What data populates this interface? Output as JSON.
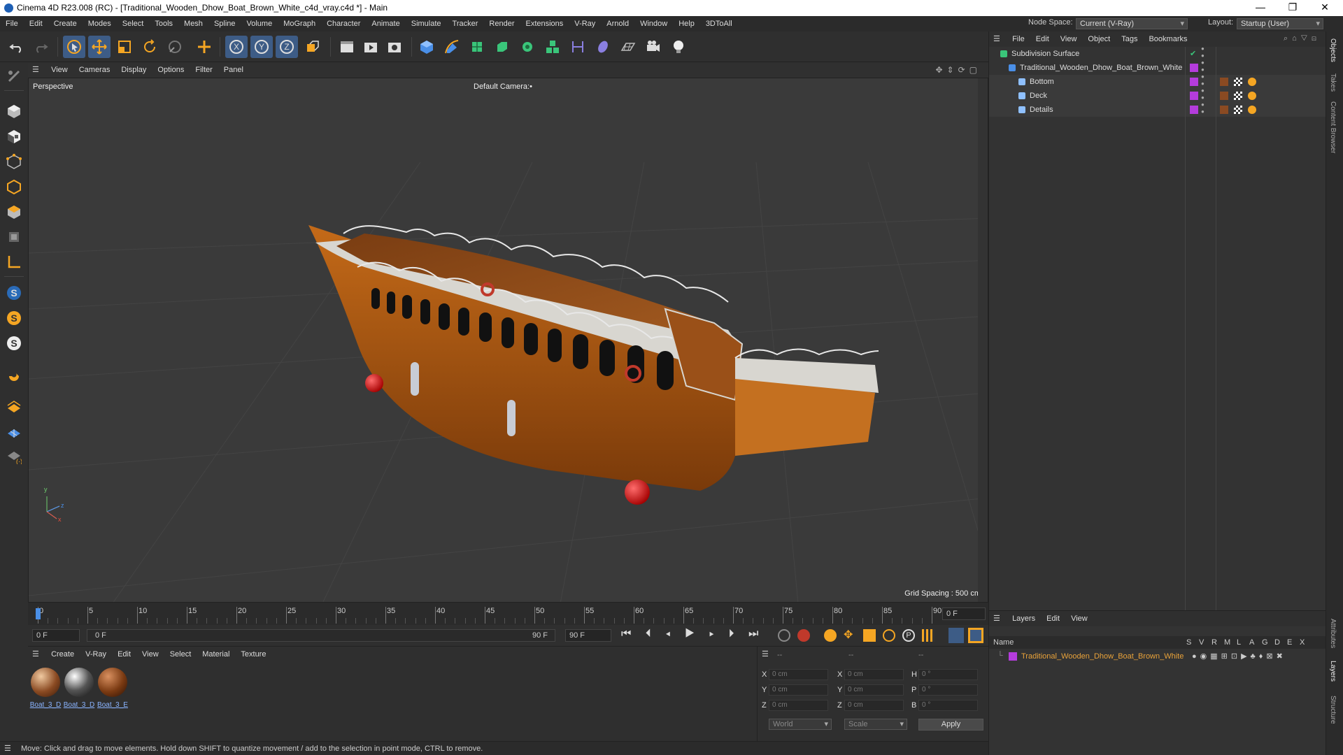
{
  "titlebar": {
    "title": "Cinema 4D R23.008 (RC) - [Traditional_Wooden_Dhow_Boat_Brown_White_c4d_vray.c4d *] - Main",
    "minimize": "—",
    "maximize": "❐",
    "close": "✕"
  },
  "menubar": {
    "items": [
      "File",
      "Edit",
      "Create",
      "Modes",
      "Select",
      "Tools",
      "Mesh",
      "Spline",
      "Volume",
      "MoGraph",
      "Character",
      "Animate",
      "Simulate",
      "Tracker",
      "Render",
      "Extensions",
      "V-Ray",
      "Arnold",
      "Window",
      "Help",
      "3DToAll"
    ],
    "node_space_label": "Node Space:",
    "node_space_value": "Current (V-Ray)",
    "layout_label": "Layout:",
    "layout_value": "Startup (User)"
  },
  "viewport": {
    "menu": [
      "View",
      "Cameras",
      "Display",
      "Options",
      "Filter",
      "Panel"
    ],
    "name": "Perspective",
    "camera": "Default Camera",
    "camera_mark": ":•",
    "grid_spacing": "Grid Spacing : 500 cm",
    "axis_y": "y",
    "axis_z": "z",
    "axis_x": "x"
  },
  "timeline": {
    "ticks": [
      "0",
      "5",
      "10",
      "15",
      "20",
      "25",
      "30",
      "35",
      "40",
      "45",
      "50",
      "55",
      "60",
      "65",
      "70",
      "75",
      "80",
      "85",
      "90"
    ],
    "current_frame": "0 F",
    "start_field": "0 F",
    "range_start": "0 F",
    "range_end": "90 F",
    "end_field": "90 F"
  },
  "material_manager": {
    "menu": [
      "Create",
      "V-Ray",
      "Edit",
      "View",
      "Select",
      "Material",
      "Texture"
    ],
    "materials": [
      {
        "label": "Boat_3_D"
      },
      {
        "label": "Boat_3_D"
      },
      {
        "label": "Boat_3_E"
      }
    ]
  },
  "coordinates": {
    "header_a": "--",
    "header_b": "--",
    "header_c": "--",
    "rows": [
      {
        "l1": "X",
        "v1": "0 cm",
        "l2": "X",
        "v2": "0 cm",
        "l3": "H",
        "v3": "0 °"
      },
      {
        "l1": "Y",
        "v1": "0 cm",
        "l2": "Y",
        "v2": "0 cm",
        "l3": "P",
        "v3": "0 °"
      },
      {
        "l1": "Z",
        "v1": "0 cm",
        "l2": "Z",
        "v2": "0 cm",
        "l3": "B",
        "v3": "0 °"
      }
    ],
    "space": "World",
    "mode": "Scale",
    "apply": "Apply"
  },
  "statusbar": {
    "text": "Move: Click and drag to move elements. Hold down SHIFT to quantize movement / add to the selection in point mode, CTRL to remove."
  },
  "objects_panel": {
    "menu": [
      "File",
      "Edit",
      "View",
      "Object",
      "Tags",
      "Bookmarks"
    ],
    "items": [
      {
        "name": "Subdivision Surface"
      },
      {
        "name": "Traditional_Wooden_Dhow_Boat_Brown_White"
      },
      {
        "name": "Bottom"
      },
      {
        "name": "Deck"
      },
      {
        "name": "Details"
      }
    ]
  },
  "layers_panel": {
    "menu": [
      "Layers",
      "Edit",
      "View"
    ],
    "col_name": "Name",
    "cols": [
      "S",
      "V",
      "R",
      "M",
      "L",
      "A",
      "G",
      "D",
      "E",
      "X"
    ],
    "layer_name": "Traditional_Wooden_Dhow_Boat_Brown_White"
  },
  "right_tabs": [
    "Objects",
    "Takes",
    "Content Browser",
    "Attributes",
    "Layers",
    "Structure"
  ],
  "colors": {
    "accent_blue": "#4a8fe7",
    "layer_purple": "#b43cdc",
    "layer_text": "#e8a23a"
  }
}
